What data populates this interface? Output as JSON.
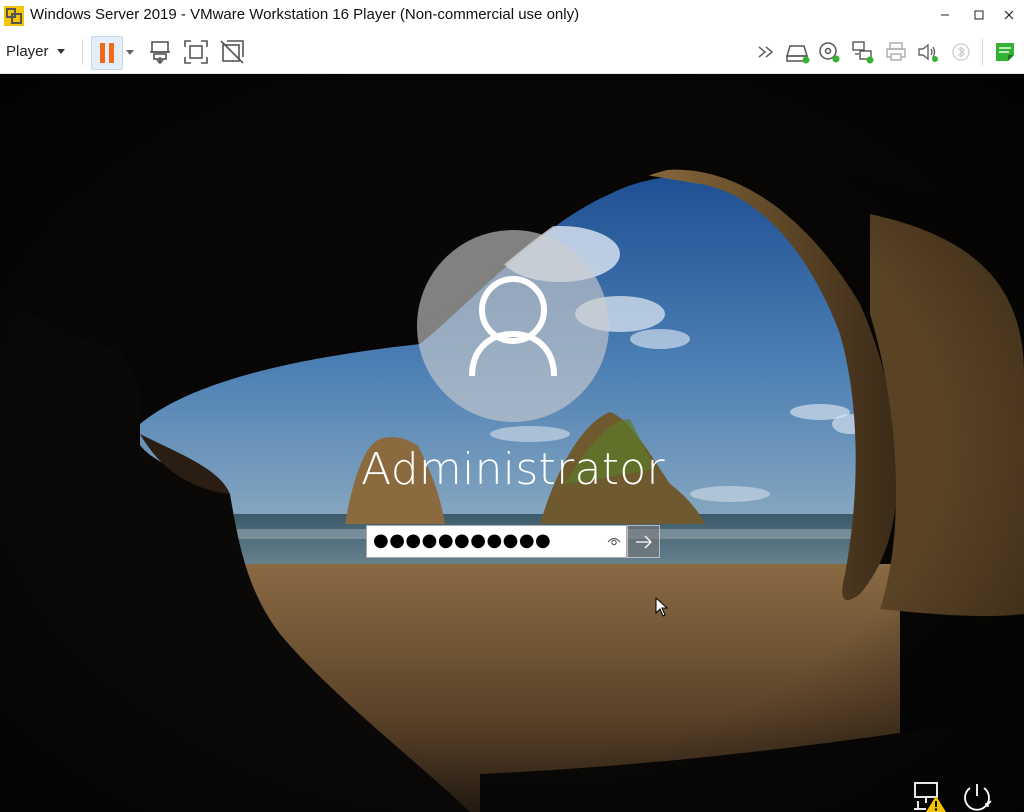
{
  "window": {
    "title": "Windows Server 2019 - VMware Workstation 16 Player (Non-commercial use only)",
    "controls": [
      "minimize-icon",
      "maximize-icon",
      "close-icon"
    ]
  },
  "toolbar": {
    "player_menu_label": "Player",
    "left_icons": [
      "pause-icon",
      "send-ctrl-alt-del-icon",
      "fullscreen-icon",
      "unity-icon"
    ],
    "right_icons": [
      "expand-icon",
      "hard-disk-icon",
      "cd-dvd-icon",
      "network-adapter-icon",
      "printer-icon",
      "sound-icon",
      "bluetooth-icon",
      "message-log-icon"
    ],
    "accent_color": "#f06a18",
    "status_green": "#34b233"
  },
  "login": {
    "username": "Administrator",
    "password_masked": "●●●●●●●●●●●",
    "icons": [
      "user-avatar-icon",
      "reveal-password-icon",
      "submit-arrow-icon"
    ]
  },
  "system_tray": {
    "icons": [
      "network-warning-icon",
      "power-icon"
    ],
    "warning_color": "#f5c400"
  }
}
